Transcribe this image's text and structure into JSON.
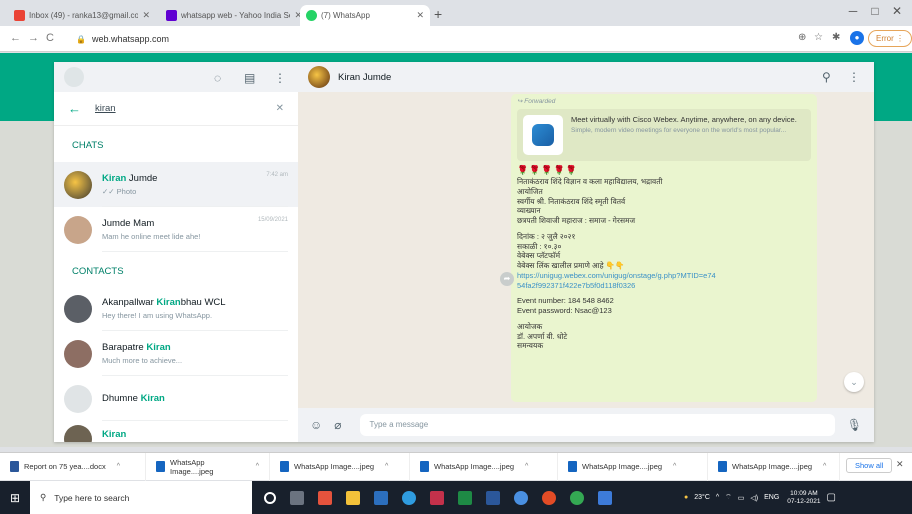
{
  "browser": {
    "tabs": [
      {
        "title": "Inbox (49) - ranka13@gmail.com",
        "icon": "gmail-icon",
        "color": "#ea4335"
      },
      {
        "title": "whatsapp web - Yahoo India Sea",
        "icon": "yahoo-icon",
        "color": "#6001d2"
      },
      {
        "title": "(7) WhatsApp",
        "icon": "whatsapp-icon",
        "color": "#25d366"
      }
    ],
    "url": "web.whatsapp.com",
    "error_label": "Error"
  },
  "whatsapp": {
    "search_query": "kiran",
    "sections": {
      "chats": "CHATS",
      "contacts": "CONTACTS"
    },
    "chats": [
      {
        "name_highlight": "Kiran",
        "name_rest": " Jumde",
        "sub": "✓✓ Photo",
        "time": "7:42 am",
        "avatar_color": "#7d6a3a"
      },
      {
        "name_highlight": "",
        "name_rest": "Jumde Mam",
        "sub": "Mam he online meet lide ahe!",
        "time": "15/09/2021",
        "avatar_color": "#c8a58a"
      }
    ],
    "contacts": [
      {
        "name_pre": "Akanpallwar ",
        "name_highlight": "Kiran",
        "name_post": "bhau WCL",
        "sub": "Hey there! I am using WhatsApp.",
        "avatar_color": "#5b5f66"
      },
      {
        "name_pre": "Barapatre ",
        "name_highlight": "Kiran",
        "name_post": "",
        "sub": "Much more to achieve...",
        "avatar_color": "#8d6e63"
      },
      {
        "name_pre": "Dhumne ",
        "name_highlight": "Kiran",
        "name_post": "",
        "sub": "",
        "avatar_color": "#e0e4e6"
      },
      {
        "name_pre": "",
        "name_highlight": "Kiran",
        "name_post": "",
        "sub": "",
        "avatar_color": "#6d6352"
      }
    ],
    "chat_header": {
      "name": "Kiran Jumde"
    },
    "message": {
      "forwarded": "↪ Forwarded",
      "preview_title": "Meet virtually with Cisco Webex. Anytime, anywhere, on any device.",
      "preview_desc": "Simple, modern video meetings for everyone on the world's most popular...",
      "flowers": "🌹🌹🌹🌹🌹",
      "lines": [
        "निताकंठराव शिंदे विज्ञान व कला महाविद्यालय, भद्रावती",
        "आयोजित",
        "स्वर्गीय श्री. निताकंठराव शिंदे स्मृती वितर्व",
        "व्याख्यान",
        "छत्रपती शिवाजी महाराज : समाज - गेरसमज"
      ],
      "date_lines": [
        "दिनांक : २ जुलै २०२१",
        "सकाळी : १०.३०",
        "वेबेक्स प्लॅटफॉर्म",
        "वेबेक्स लिंक खालील प्रमाणे आहे 👇👇"
      ],
      "link": "https://unigug.webex.com/unigug/onstage/g.php?MTID=e7454fa2f992371f422e7b5f0d118f0326",
      "event_number": "Event number: 184 548 8462",
      "event_password": "Event password:   Nsac@123",
      "organizer_lines": [
        "आयोजक",
        "डॉ. अपर्णा वी. धोटे",
        "समन्वयक"
      ]
    },
    "input_placeholder": "Type a message"
  },
  "downloads": {
    "items": [
      "Report on 75 yea....docx",
      "WhatsApp Image....jpeg",
      "WhatsApp Image....jpeg",
      "WhatsApp Image....jpeg",
      "WhatsApp Image....jpeg",
      "WhatsApp Image....jpeg"
    ],
    "show_all": "Show all"
  },
  "taskbar": {
    "search_placeholder": "Type here to search",
    "weather": "23°C",
    "lang": "ENG",
    "time": "10:09 AM",
    "date": "07-12-2021"
  }
}
